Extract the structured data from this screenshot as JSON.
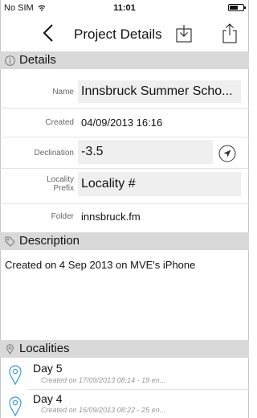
{
  "statusbar": {
    "carrier": "No SIM",
    "time": "11:01"
  },
  "navbar": {
    "title": "Project Details"
  },
  "details": {
    "header": "Details",
    "name_label": "Name",
    "name_value": "Innsbruck Summer Scho...",
    "created_label": "Created",
    "created_value": "04/09/2013 16:16",
    "declination_label": "Declination",
    "declination_value": "-3.5",
    "locality_prefix_label_1": "Locality",
    "locality_prefix_label_2": "Prefix",
    "locality_prefix_value": "Locality #",
    "folder_label": "Folder",
    "folder_value": "innsbruck.fm"
  },
  "description": {
    "header": "Description",
    "text": "Created on 4 Sep 2013 on MVE's iPhone"
  },
  "localities": {
    "header": "Localities",
    "items": [
      {
        "title": "Day 5",
        "subtitle": "Created on 17/09/2013 08:14 - 19 en..."
      },
      {
        "title": "Day 4",
        "subtitle": "Created on 16/09/2013 08:22 - 25 en..."
      }
    ]
  },
  "colors": {
    "accent": "#3a9bd5",
    "section_bg": "#d9d9d9",
    "field_bg": "#efefef"
  }
}
